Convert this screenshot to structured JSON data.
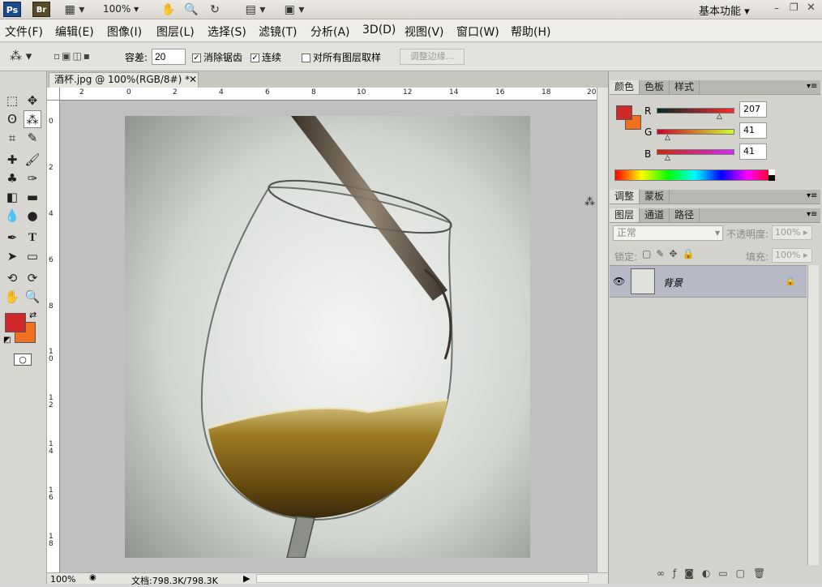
{
  "appbar": {
    "ps_logo": "Ps",
    "br_logo": "Br",
    "zoom": "100%",
    "workspace": "基本功能",
    "icons": [
      "screen-mode-icon",
      "hand-icon",
      "zoom-icon",
      "rotate-view-icon",
      "arrange-documents-icon",
      "screen-mode-icon"
    ]
  },
  "menu": [
    "文件(F)",
    "编辑(E)",
    "图像(I)",
    "图层(L)",
    "选择(S)",
    "滤镜(T)",
    "分析(A)",
    "3D(D)",
    "视图(V)",
    "窗口(W)",
    "帮助(H)"
  ],
  "options": {
    "tolerance_label": "容差:",
    "tolerance_value": "20",
    "antialias_label": "消除锯齿",
    "antialias_checked": true,
    "contiguous_label": "连续",
    "contiguous_checked": true,
    "sample_all_label": "对所有图层取样",
    "sample_all_checked": false,
    "refine_edge_label": "调整边缘..."
  },
  "document": {
    "tab_title": "酒杯.jpg @ 100%(RGB/8#) *",
    "ruler_h": [
      "2",
      "0",
      "2",
      "4",
      "6",
      "8",
      "10",
      "12",
      "14",
      "16",
      "18",
      "20"
    ],
    "ruler_v": [
      "0",
      "2",
      "4",
      "6",
      "8",
      "10",
      "12",
      "14",
      "16",
      "18"
    ],
    "status_zoom": "100%",
    "status_doc": "文档:798.3K/798.3K"
  },
  "colors": {
    "foreground": "#cf2929",
    "background": "#f07020",
    "accent": "#1c4a8a"
  },
  "color_panel": {
    "tabs": [
      "颜色",
      "色板",
      "样式"
    ],
    "channels": [
      {
        "label": "R",
        "value": "207"
      },
      {
        "label": "G",
        "value": "41"
      },
      {
        "label": "B",
        "value": "41"
      }
    ]
  },
  "adjust_panel": {
    "tabs": [
      "调整",
      "蒙板"
    ]
  },
  "layers_panel": {
    "tabs": [
      "图层",
      "通道",
      "路径"
    ],
    "blend_mode": "正常",
    "opacity_label": "不透明度:",
    "opacity_value": "100%",
    "lock_label": "锁定:",
    "fill_label": "填充:",
    "fill_value": "100%",
    "layers": [
      {
        "name": "背景",
        "visible": true,
        "locked": true
      }
    ]
  }
}
